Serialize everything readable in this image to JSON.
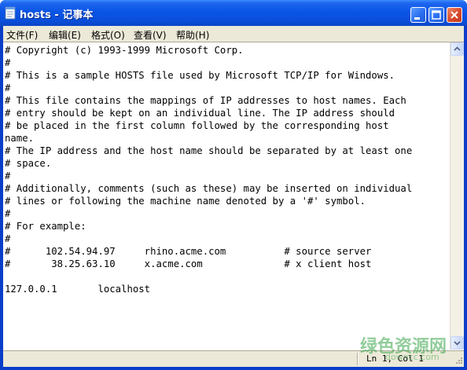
{
  "window": {
    "title": "hosts - 记事本",
    "app_icon": "notepad-icon",
    "buttons": [
      "minimize-icon",
      "maximize-icon",
      "close-icon"
    ]
  },
  "menu": {
    "file": "文件(F)",
    "edit": "编辑(E)",
    "format": "格式(O)",
    "view": "查看(V)",
    "help": "帮助(H)"
  },
  "editor": {
    "content": "# Copyright (c) 1993-1999 Microsoft Corp.\n#\n# This is a sample HOSTS file used by Microsoft TCP/IP for Windows.\n#\n# This file contains the mappings of IP addresses to host names. Each\n# entry should be kept on an individual line. The IP address should\n# be placed in the first column followed by the corresponding host\nname.\n# The IP address and the host name should be separated by at least one\n# space.\n#\n# Additionally, comments (such as these) may be inserted on individual\n# lines or following the machine name denoted by a '#' symbol.\n#\n# For example:\n#\n#      102.54.94.97     rhino.acme.com          # source server\n#       38.25.63.10     x.acme.com              # x client host\n\n127.0.0.1       localhost"
  },
  "status": {
    "position": "Ln 1, Col 1"
  },
  "watermark": {
    "text": "绿色资源网",
    "sub": "downcc.com"
  },
  "colors": {
    "title_bar": "#0a55e6",
    "close_button": "#d9492a",
    "chrome": "#ece9d8",
    "watermark": "#3aa64a"
  }
}
